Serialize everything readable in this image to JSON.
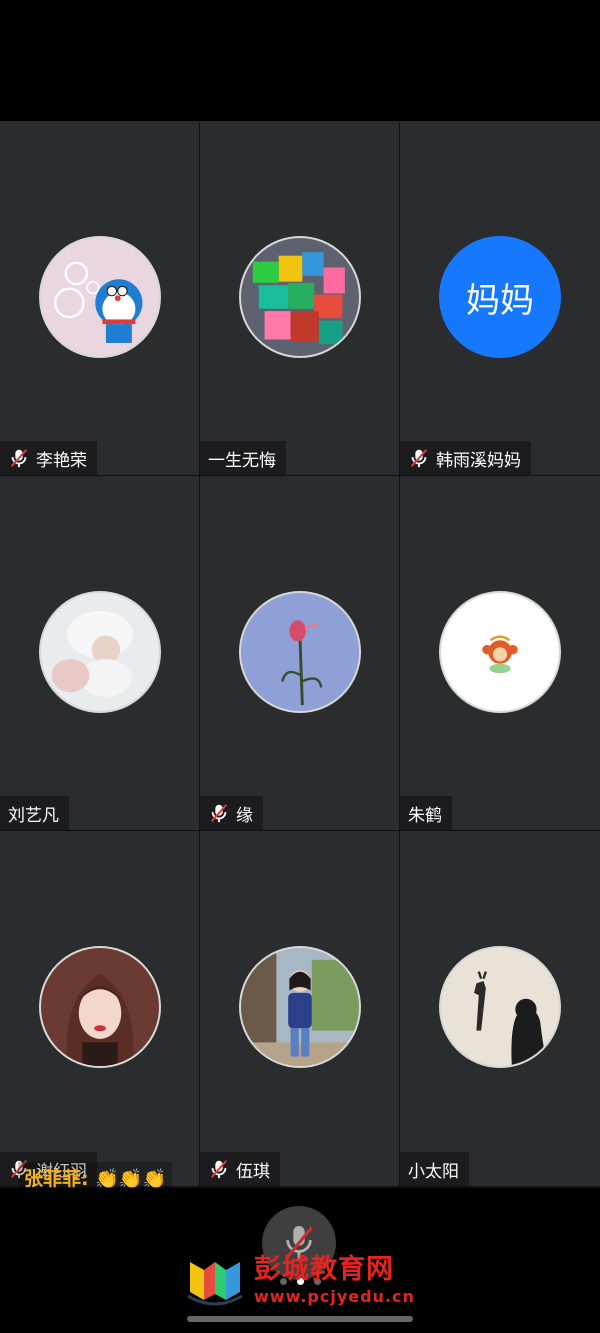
{
  "participants": [
    {
      "name": "李艳荣",
      "muted": true,
      "avatar": "doraemon-bubbles-avatar"
    },
    {
      "name": "一生无悔",
      "muted": false,
      "avatar": "lego-blocks-avatar"
    },
    {
      "name": "韩雨溪妈妈",
      "muted": true,
      "avatar_text": "妈妈",
      "avatar_color": "#1677ff"
    },
    {
      "name": "刘艺凡",
      "muted": false,
      "avatar": "baby-photo-avatar"
    },
    {
      "name": "缘",
      "muted": true,
      "avatar": "red-flower-avatar"
    },
    {
      "name": "朱鹤",
      "muted": false,
      "avatar": "monkey-sticker-avatar"
    },
    {
      "name": "谢红羽",
      "muted": true,
      "avatar": "woman-portrait-avatar"
    },
    {
      "name": "伍琪",
      "muted": true,
      "avatar": "woman-standing-avatar"
    },
    {
      "name": "小太阳",
      "muted": false,
      "avatar": "giraffe-shadow-avatar"
    }
  ],
  "chat_bubble": {
    "sender": "张菲菲:",
    "content": "👏👏👏"
  },
  "controls": {
    "mic_icon": "mic-off-icon",
    "page_count": 3,
    "active_page": 2
  },
  "watermark": {
    "title": "彭城教育网",
    "url": "www.pcjyedu.cn"
  },
  "colors": {
    "tile_bg": "#2b2c2e",
    "accent_blue": "#1677ff",
    "mute_red": "#e53935",
    "chat_yellow": "#f3b21b"
  }
}
